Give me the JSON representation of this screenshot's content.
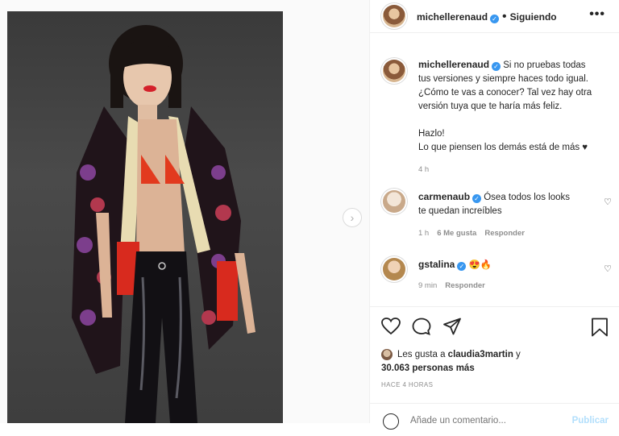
{
  "post": {
    "username": "michellerenaud",
    "follow_status": "Siguiendo",
    "more_icon": "•••",
    "caption_lines": [
      "Si no pruebas todas",
      "tus versiones y siempre haces todo igual.",
      "¿Cómo te vas a conocer? Tal vez hay otra",
      "versión tuya que te haría más feliz."
    ],
    "caption_2": "Hazlo!",
    "caption_3": "Lo que piensen los demás está de más ♥",
    "caption_time": "4 h"
  },
  "comments": [
    {
      "username": "carmenaub",
      "text_line1": "Ósea todos los looks",
      "text_line2": "te quedan increíbles",
      "time": "1 h",
      "likes": "6 Me gusta",
      "reply": "Responder"
    },
    {
      "username": "gstalina",
      "text": "😍🔥",
      "time": "9 min",
      "reply": "Responder"
    }
  ],
  "likes": {
    "prefix": "Les gusta a",
    "user": "claudia3martin",
    "connector": "y",
    "count": "30.063 personas más"
  },
  "post_time": "HACE 4 HORAS",
  "add_comment": {
    "placeholder": "Añade un comentario...",
    "publish": "Publicar"
  },
  "next_icon": "›",
  "icons": [
    "heart-icon",
    "comment-icon",
    "share-icon",
    "bookmark-icon",
    "chevron-right-icon",
    "verified-icon",
    "emoji-icon"
  ],
  "colors": {
    "verified": "#3897f0",
    "muted": "#8e8e8e",
    "publish": "#b2dffc"
  }
}
